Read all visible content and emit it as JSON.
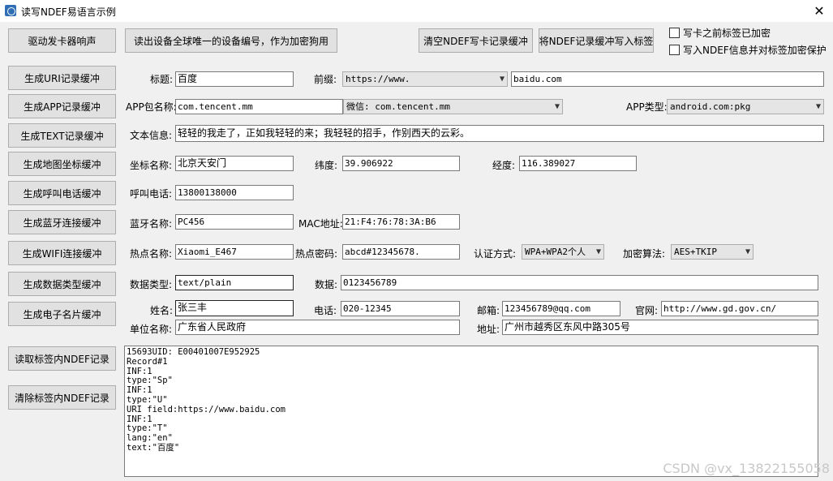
{
  "window": {
    "title": "读写NDEF易语言示例",
    "close": "✕"
  },
  "buttons": {
    "beep": "驱动发卡器响声",
    "read_uid": "读出设备全球唯一的设备编号，作为加密狗用",
    "clear_buffer": "清空NDEF写卡记录缓冲",
    "write_buffer": "将NDEF记录缓冲写入标签",
    "gen_uri": "生成URI记录缓冲",
    "gen_app": "生成APP记录缓冲",
    "gen_text": "生成TEXT记录缓冲",
    "gen_map": "生成地图坐标缓冲",
    "gen_call": "生成呼叫电话缓冲",
    "gen_bt": "生成蓝牙连接缓冲",
    "gen_wifi": "生成WIFI连接缓冲",
    "gen_data": "生成数据类型缓冲",
    "gen_vcard": "生成电子名片缓冲",
    "read_ndef": "读取标签内NDEF记录",
    "clear_ndef": "清除标签内NDEF记录"
  },
  "checkboxes": {
    "encrypted": "写卡之前标签已加密",
    "protect": "写入NDEF信息并对标签加密保护"
  },
  "uri": {
    "title_label": "标题:",
    "title_value": "百度",
    "prefix_label": "前缀:",
    "prefix_value": "https://www.",
    "url_value": "baidu.com"
  },
  "app": {
    "pkg_label": "APP包名称:",
    "pkg_value": "com.tencent.mm",
    "wechat_value": "微信: com.tencent.mm",
    "type_label": "APP类型:",
    "type_value": "android.com:pkg"
  },
  "text": {
    "label": "文本信息:",
    "value": "轻轻的我走了，正如我轻轻的来；我轻轻的招手，作别西天的云彩。"
  },
  "map": {
    "name_label": "坐标名称:",
    "name_value": "北京天安门",
    "lat_label": "纬度:",
    "lat_value": "39.906922",
    "lon_label": "经度:",
    "lon_value": "116.389027"
  },
  "call": {
    "label": "呼叫电话:",
    "value": "13800138000"
  },
  "bt": {
    "name_label": "蓝牙名称:",
    "name_value": "PC456",
    "mac_label": "MAC地址:",
    "mac_value": "21:F4:76:78:3A:B6"
  },
  "wifi": {
    "ssid_label": "热点名称:",
    "ssid_value": "Xiaomi_E467",
    "pwd_label": "热点密码:",
    "pwd_value": "abcd#12345678.",
    "auth_label": "认证方式:",
    "auth_value": "WPA+WPA2个人",
    "enc_label": "加密算法:",
    "enc_value": "AES+TKIP"
  },
  "data": {
    "type_label": "数据类型:",
    "type_value": "text/plain",
    "data_label": "数据:",
    "data_value": "0123456789"
  },
  "vcard": {
    "name_label": "姓名:",
    "name_value": "张三丰",
    "phone_label": "电话:",
    "phone_value": "020-12345",
    "email_label": "邮箱:",
    "email_value": "123456789@qq.com",
    "web_label": "官网:",
    "web_value": "http://www.gd.gov.cn/",
    "org_label": "单位名称:",
    "org_value": "广东省人民政府",
    "addr_label": "地址:",
    "addr_value": "广州市越秀区东风中路305号"
  },
  "output_lines": [
    "15693UID: E00401007E952925",
    "Record#1",
    "INF:1",
    "type:\"Sp\"",
    "INF:1",
    "type:\"U\"",
    "URI field:https://www.baidu.com",
    "INF:1",
    "type:\"T\"",
    "lang:\"en\"",
    "text:\"百度\""
  ],
  "watermark": "CSDN @vx_13822155058"
}
